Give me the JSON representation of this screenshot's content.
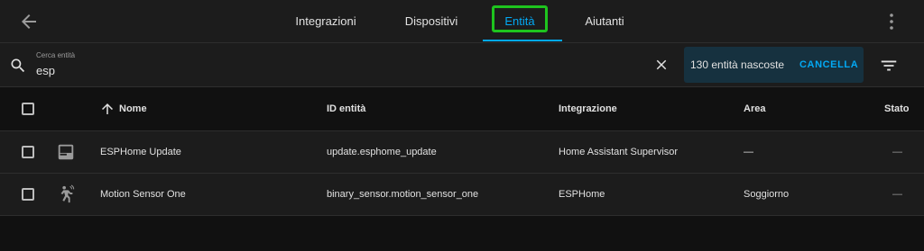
{
  "tabs": [
    {
      "label": "Integrazioni"
    },
    {
      "label": "Dispositivi"
    },
    {
      "label": "Entità"
    },
    {
      "label": "Aiutanti"
    }
  ],
  "active_tab": "Entità",
  "accent_color": "#03a9f4",
  "highlight_color": "#1ec41e",
  "search": {
    "label": "Cerca entità",
    "value": "esp"
  },
  "hidden_notice": {
    "text": "130 entità nascoste",
    "action": "CANCELLA"
  },
  "table": {
    "headers": {
      "name": "Nome",
      "entity_id": "ID entità",
      "integration": "Integrazione",
      "area": "Area",
      "status": "Stato"
    },
    "rows": [
      {
        "icon": "update-icon",
        "name": "ESPHome Update",
        "entity_id": "update.esphome_update",
        "integration": "Home Assistant Supervisor",
        "area": "—",
        "status": "—"
      },
      {
        "icon": "motion-sensor-icon",
        "name": "Motion Sensor One",
        "entity_id": "binary_sensor.motion_sensor_one",
        "integration": "ESPHome",
        "area": "Soggiorno",
        "status": "—"
      }
    ]
  }
}
